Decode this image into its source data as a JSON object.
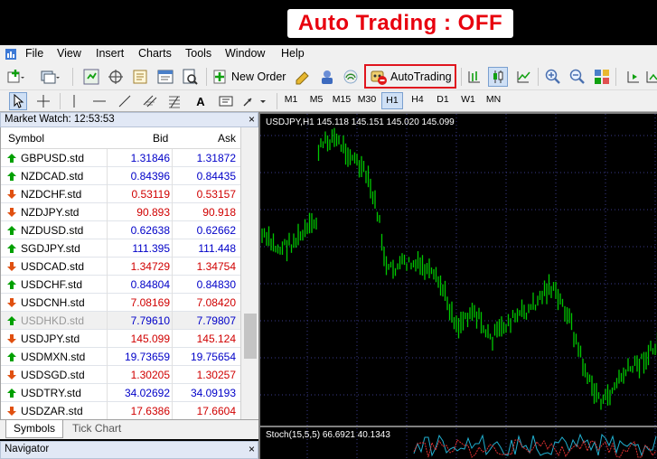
{
  "banner": {
    "label": "Auto Trading : OFF"
  },
  "menu": [
    "File",
    "View",
    "Insert",
    "Charts",
    "Tools",
    "Window",
    "Help"
  ],
  "toolbar": {
    "new_order": "New Order",
    "auto_trading": "AutoTrading"
  },
  "timeframes": [
    "M1",
    "M5",
    "M15",
    "M30",
    "H1",
    "H4",
    "D1",
    "W1",
    "MN"
  ],
  "market_watch": {
    "title": "Market Watch: 12:53:53",
    "columns": [
      "Symbol",
      "Bid",
      "Ask"
    ],
    "rows": [
      {
        "symbol": "GBPUSD.std",
        "bid": "1.31846",
        "ask": "1.31872",
        "dir": "up"
      },
      {
        "symbol": "NZDCAD.std",
        "bid": "0.84396",
        "ask": "0.84435",
        "dir": "up"
      },
      {
        "symbol": "NZDCHF.std",
        "bid": "0.53119",
        "ask": "0.53157",
        "dir": "down"
      },
      {
        "symbol": "NZDJPY.std",
        "bid": "90.893",
        "ask": "90.918",
        "dir": "down"
      },
      {
        "symbol": "NZDUSD.std",
        "bid": "0.62638",
        "ask": "0.62662",
        "dir": "up"
      },
      {
        "symbol": "SGDJPY.std",
        "bid": "111.395",
        "ask": "111.448",
        "dir": "up"
      },
      {
        "symbol": "USDCAD.std",
        "bid": "1.34729",
        "ask": "1.34754",
        "dir": "down"
      },
      {
        "symbol": "USDCHF.std",
        "bid": "0.84804",
        "ask": "0.84830",
        "dir": "up"
      },
      {
        "symbol": "USDCNH.std",
        "bid": "7.08169",
        "ask": "7.08420",
        "dir": "down"
      },
      {
        "symbol": "USDHKD.std",
        "bid": "7.79610",
        "ask": "7.79807",
        "dir": "up",
        "muted": true
      },
      {
        "symbol": "USDJPY.std",
        "bid": "145.099",
        "ask": "145.124",
        "dir": "down"
      },
      {
        "symbol": "USDMXN.std",
        "bid": "19.73659",
        "ask": "19.75654",
        "dir": "up"
      },
      {
        "symbol": "USDSGD.std",
        "bid": "1.30205",
        "ask": "1.30257",
        "dir": "down"
      },
      {
        "symbol": "USDTRY.std",
        "bid": "34.02692",
        "ask": "34.09193",
        "dir": "up"
      },
      {
        "symbol": "USDZAR.std",
        "bid": "17.6386",
        "ask": "17.6604",
        "dir": "down"
      }
    ],
    "tabs": [
      "Symbols",
      "Tick Chart"
    ]
  },
  "navigator": {
    "title": "Navigator"
  },
  "chart": {
    "label": "USDJPY,H1  145.118 145.151 145.020 145.099",
    "stoch_label": "Stoch(15,5,5) 66.6921 40.1343"
  },
  "colors": {
    "up": "#00a000",
    "down": "#e05010",
    "bid": "#0000c8",
    "ask_down": "#d00000",
    "candle": "#00c800",
    "grid": "#3a3a8a"
  }
}
